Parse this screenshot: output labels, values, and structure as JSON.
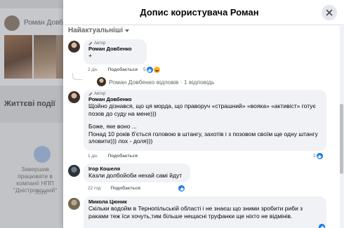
{
  "background": {
    "profile_name": "Роман Довбе",
    "section_title": "Життєві події",
    "event_text": "Завершив працювати в компанії НПП \"Дністровський\"",
    "event_year": "2016"
  },
  "dialog": {
    "title": "Допис користувача Роман",
    "sort_label": "Найактуальніші"
  },
  "comments": [
    {
      "badge": "Автор",
      "name": "Роман Довбенко",
      "text": "+",
      "time": "2 дн.",
      "like_label": "Подобається",
      "reactions": "5"
    },
    {
      "replies_summary": "Роман Довбенко відповів · 1 відповідь"
    },
    {
      "badge": "Автор",
      "name": "Роман Довбенко",
      "text_1": "Щойно дізнався, що ця морда, що праворуч «страшний» «вояка» «активіст» готує позов до суду на мене)))",
      "text_2": "Боже, яке воно ...",
      "text_3": "Понад 10 років б'ється головою в штангу, захотів і з позовом своїм ще одну штангу зловити))) лох - доля)))",
      "time": "1 дн.",
      "like_label": "Подобається",
      "reactions": "2"
    },
    {
      "name": "Ігор Кошеля",
      "text": "Казли долбойоби нехай самі йдут",
      "time": "22 год",
      "like_label": "Подобається"
    },
    {
      "name": "Микола Цюник",
      "text": "Скільки водойм в Тернопільській області і не знаєш що зними зробити риби з раками теж їси хочуть,тим більше нещасні труфанки ще ніхто не відмінів."
    }
  ],
  "colors": {
    "accent": "#1877f2",
    "bubble": "#f0f2f5",
    "secondary_text": "#65676b"
  }
}
